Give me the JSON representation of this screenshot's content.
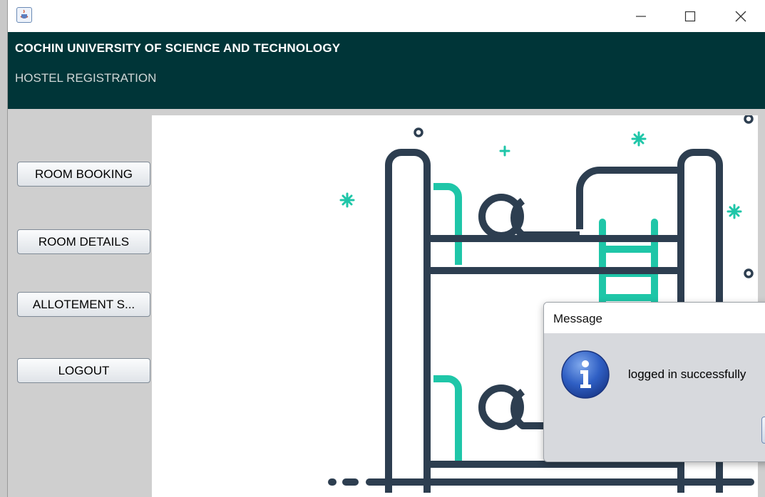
{
  "window": {
    "header_title": "COCHIN UNIVERSITY OF SCIENCE AND TECHNOLOGY",
    "header_subtitle": "HOSTEL REGISTRATION",
    "controls": [
      "minimize-icon",
      "maximize-icon",
      "close-icon"
    ]
  },
  "sidebar": {
    "items": [
      {
        "label": "ROOM BOOKING"
      },
      {
        "label": "ROOM DETAILS"
      },
      {
        "label": "ALLOTEMENT S..."
      },
      {
        "label": "LOGOUT"
      }
    ]
  },
  "main": {
    "illustration": "bunk-bed-illustration",
    "colors": {
      "line": "#2d3e50",
      "accent": "#1fc6a8"
    }
  },
  "dialog": {
    "title": "Message",
    "message": "logged in successfully",
    "icon": "info-icon"
  }
}
